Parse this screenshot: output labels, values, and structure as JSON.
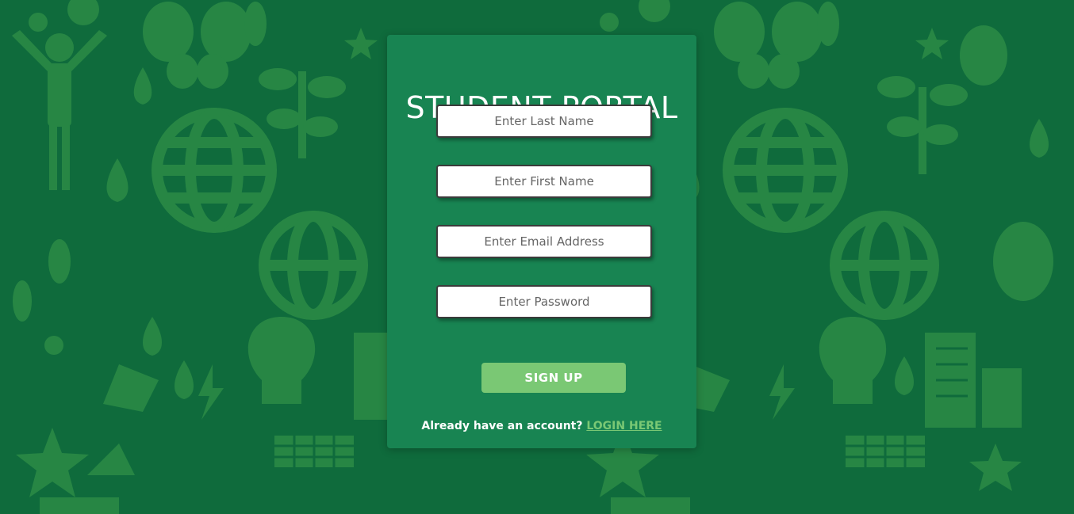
{
  "page": {
    "title": "STUDENT PORTAL"
  },
  "form": {
    "last_name_placeholder": "Enter Last Name",
    "first_name_placeholder": "Enter First Name",
    "email_placeholder": "Enter Email Address",
    "password_placeholder": "Enter Password",
    "signup_label": "SIGN UP"
  },
  "footer": {
    "prompt": "Already have an account?",
    "login_link": "LOGIN HERE"
  },
  "colors": {
    "background": "#0f6b3c",
    "pattern": "#2a8a45",
    "card": "#188452",
    "button": "#7ac874",
    "link": "#7ac874"
  },
  "background_icons": [
    "globe-icon",
    "leaf-icon",
    "tree-icon",
    "water-drop-icon",
    "star-icon",
    "gear-icon",
    "recycle-icon",
    "building-icon",
    "solar-panel-icon",
    "butterfly-icon",
    "person-icon",
    "lightning-icon"
  ]
}
